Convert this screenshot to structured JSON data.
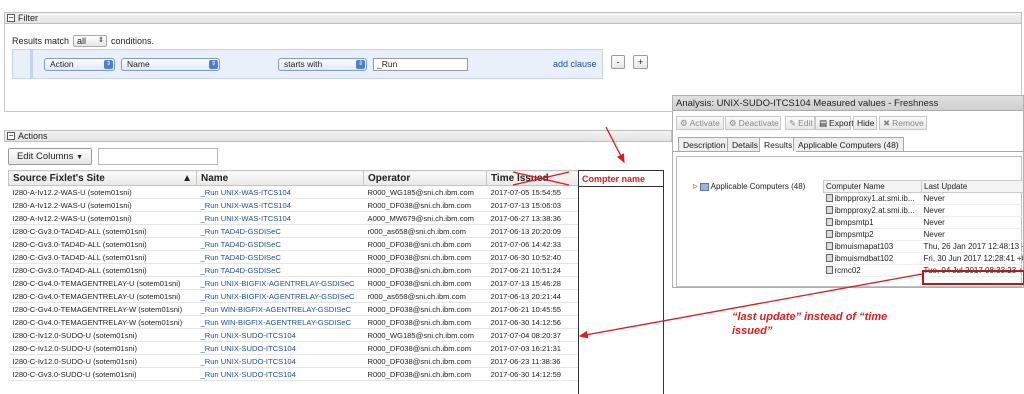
{
  "filter": {
    "title": "Filter",
    "results_prefix": "Results match",
    "match_value": "all",
    "results_suffix": "conditions.",
    "clause": {
      "field": "Action",
      "property": "Name",
      "operator": "starts with",
      "value": "_Run"
    },
    "add_clause": "add clause",
    "minus": "-",
    "plus": "+"
  },
  "actions": {
    "title": "Actions",
    "edit_columns": "Edit Columns",
    "columns": [
      "Source Fixlet's Site",
      "Name",
      "Operator",
      "Time Issued"
    ],
    "rows": [
      [
        "I280-A-Iv12.2-WAS-U (sotem01sni)",
        "_Run UNIX-WAS-ITCS104",
        "R000_WG185@sni.ch.ibm.com",
        "2017-07-05 15:54:55"
      ],
      [
        "I280-A-Iv12.2-WAS-U (sotem01sni)",
        "_Run UNIX-WAS-ITCS104",
        "R000_DF038@sni.ch.ibm.com",
        "2017-07-13 15:06:03"
      ],
      [
        "I280-A-Iv12.2-WAS-U (sotem01sni)",
        "_Run UNIX-WAS-ITCS104",
        "A000_MW679@sni.ch.ibm.com",
        "2017-06-27 13:38:36"
      ],
      [
        "I280-C-Gv3.0-TAD4D-ALL (sotem01sni)",
        "_Run TAD4D-GSDISeC",
        "r000_as658@sni.ch.ibm.com",
        "2017-06-13 20:20:09"
      ],
      [
        "I280-C-Gv3.0-TAD4D-ALL (sotem01sni)",
        "_Run TAD4D-GSDISeC",
        "R000_DF038@sni.ch.ibm.com",
        "2017-07-06 14:42:33"
      ],
      [
        "I280-C-Gv3.0-TAD4D-ALL (sotem01sni)",
        "_Run TAD4D-GSDISeC",
        "R000_DF038@sni.ch.ibm.com",
        "2017-06-30 10:52:40"
      ],
      [
        "I280-C-Gv3.0-TAD4D-ALL (sotem01sni)",
        "_Run TAD4D-GSDISeC",
        "R000_DF038@sni.ch.ibm.com",
        "2017-06-21 10:51:24"
      ],
      [
        "I280-C-Gv4.0-TEMAGENTRELAY-U (sotem01sni)",
        "_Run UNIX-BIGFIX-AGENTRELAY-GSDISeC",
        "R000_DF038@sni.ch.ibm.com",
        "2017-07-13 15:46:28"
      ],
      [
        "I280-C-Gv4.0-TEMAGENTRELAY-U (sotem01sni)",
        "_Run UNIX-BIGFIX-AGENTRELAY-GSDISeC",
        "r000_as658@sni.ch.ibm.com",
        "2017-06-13 20:21:44"
      ],
      [
        "I280-C-Gv4.0-TEMAGENTRELAY-W (sotem01sni)",
        "_Run WIN-BIGFIX-AGENTRELAY-GSDISeC",
        "R000_DF038@sni.ch.ibm.com",
        "2017-06-21 10:45:55"
      ],
      [
        "I280-C-Gv4.0-TEMAGENTRELAY-W (sotem01sni)",
        "_Run WIN-BIGFIX-AGENTRELAY-GSDISeC",
        "R000_DF038@sni.ch.ibm.com",
        "2017-06-30 14:12:56"
      ],
      [
        "I280-C-Iv12.0-SUDO-U (sotem01sni)",
        "_Run UNIX-SUDO-ITCS104",
        "R000_WG185@sni.ch.ibm.com",
        "2017-07-04 08:20:37"
      ],
      [
        "I280-C-Iv12.0-SUDO-U (sotem01sni)",
        "_Run UNIX-SUDO-ITCS104",
        "R000_DF038@sni.ch.ibm.com",
        "2017-07-03 16:21:31"
      ],
      [
        "I280-C-Iv12.0-SUDO-U (sotem01sni)",
        "_Run UNIX-SUDO-ITCS104",
        "R000_DF038@sni.ch.ibm.com",
        "2017-06-23 11:38:36"
      ]
    ],
    "partial_row": [
      "I280-C-Gv3.0-SUDO-U (sotem01sni)",
      "_Run UNIX-SUDO-ITCS104",
      "R000_DF038@sni.ch.ibm.com",
      "2017-06-30 14:12:59"
    ]
  },
  "annotation": {
    "computer_name_header": "Compter name",
    "note": "“last update” instead of “time issued”",
    "color": "#e3191c"
  },
  "analysis": {
    "title": "Analysis: UNIX-SUDO-ITCS104 Measured values - Freshness",
    "toolbar": [
      "Activate",
      "Deactivate",
      "Edit",
      "Export",
      "Hide",
      "Remove"
    ],
    "tabs": [
      "Description",
      "Details",
      "Results",
      "Applicable Computers (48)"
    ],
    "tree_item": "Applicable Computers (48)",
    "columns": [
      "Computer Name",
      "Last Update"
    ],
    "rows": [
      [
        "ibmpproxy1.at.smi.ib...",
        "Never"
      ],
      [
        "ibmpproxy2.at.smi.ib...",
        "Never"
      ],
      [
        "ibmpsmtp1",
        "Never"
      ],
      [
        "ibmpsmtp2",
        "Never"
      ],
      [
        "ibmuismapat103",
        "Thu, 26 Jan 2017 12:48:13 +0"
      ],
      [
        "ibmuismdbat102",
        "Fri, 30 Jun 2017 12:28:41 +0"
      ],
      [
        "rcmc02",
        "Tue, 04 Jul 2017 08:33:23 +0"
      ]
    ]
  }
}
